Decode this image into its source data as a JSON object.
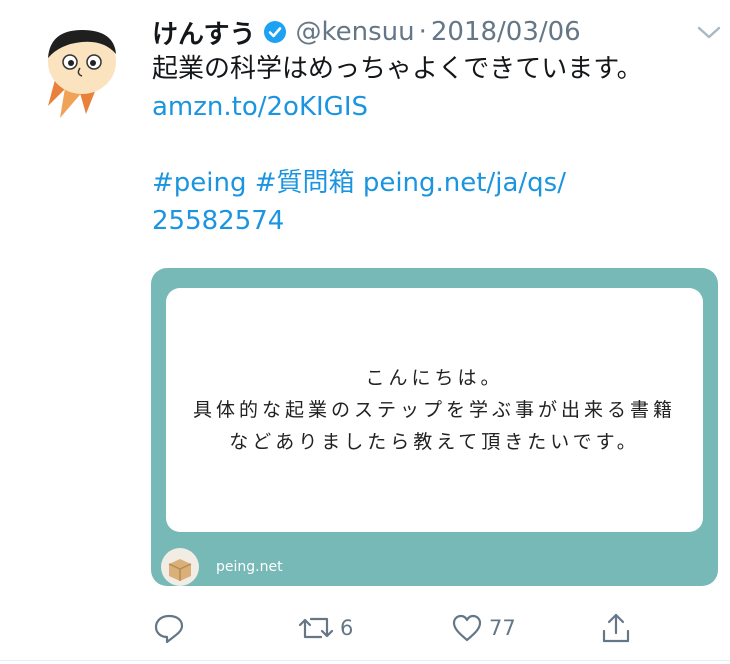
{
  "tweet": {
    "author": {
      "display_name": "けんすう",
      "handle": "@kensuu"
    },
    "separator": "·",
    "date": "2018/03/06",
    "body": {
      "text": "起業の科学はめっちゃよくできています。",
      "link": "amzn.to/2oKIGIS",
      "hashtag_1": "#peing",
      "hashtag_2": "#質問箱",
      "link_2_part_1": "peing.net/ja/qs/",
      "link_2_part_2": "25582574"
    },
    "card": {
      "question_lines": [
        "こんにちは。",
        "具体的な起業のステップを学ぶ事が出来る書籍",
        "などありましたら教えて頂きたいです。"
      ],
      "source": "peing.net"
    },
    "actions": {
      "reply_count": "",
      "retweet_count": "6",
      "like_count": "77"
    }
  },
  "icons": [
    "avatar-icon",
    "verified-icon",
    "chevron-down-icon",
    "peing-box-icon",
    "reply-icon",
    "retweet-icon",
    "like-icon",
    "share-icon"
  ],
  "colors": {
    "link": "#1b95e0",
    "card_background": "#76b9b7",
    "secondary_text": "#657786",
    "verified": "#1da1f2"
  }
}
